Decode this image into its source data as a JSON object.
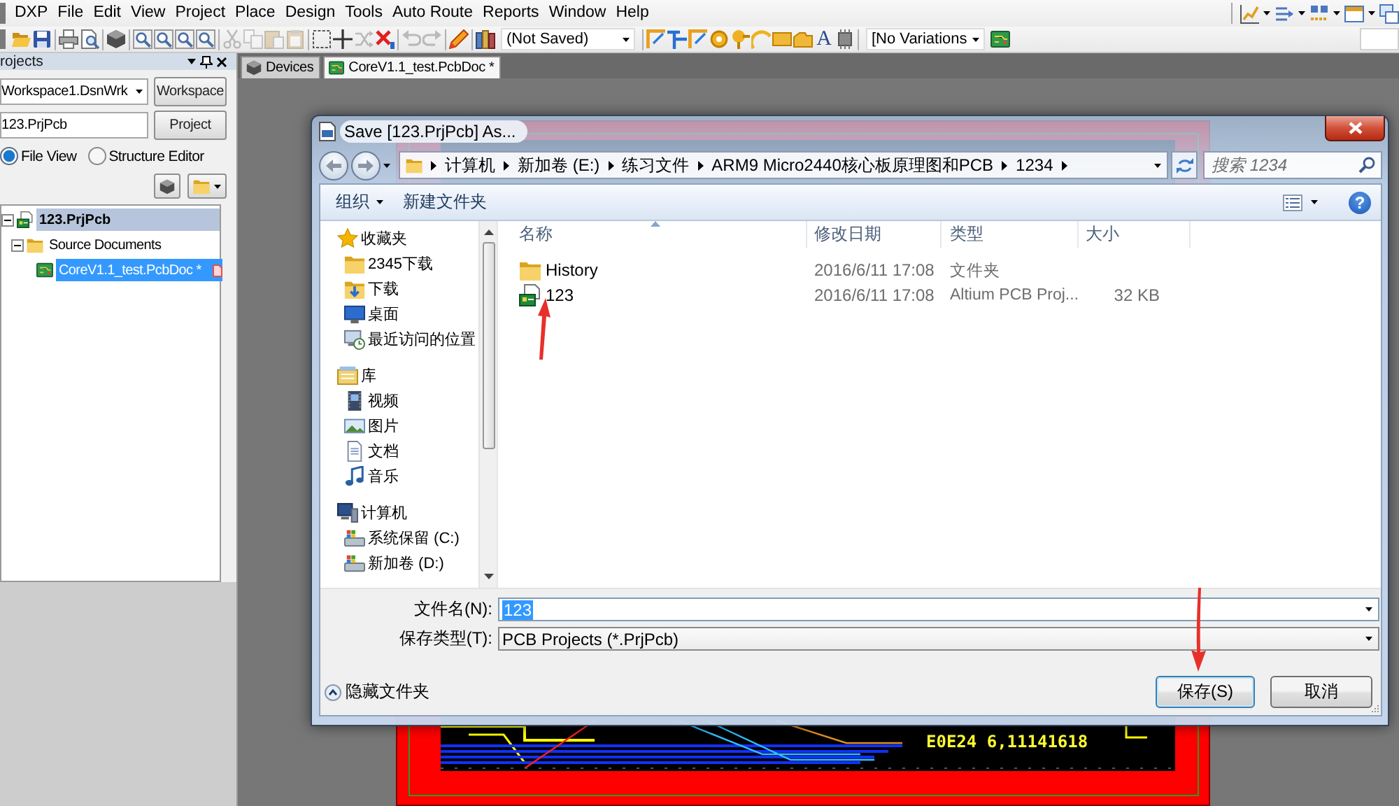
{
  "menu_bar": {
    "items": [
      "DXP",
      "File",
      "Edit",
      "View",
      "Project",
      "Place",
      "Design",
      "Tools",
      "Auto Route",
      "Reports",
      "Window",
      "Help"
    ],
    "tools": [
      {
        "kind": "chart"
      },
      {
        "kind": "align"
      },
      {
        "kind": "blocks"
      },
      {
        "kind": "panel"
      },
      {
        "kind": "windows"
      }
    ]
  },
  "toolbar": {
    "edit_groups": [
      [
        {
          "kind": "folder",
          "disabled": false
        },
        {
          "kind": "floppy",
          "disabled": false
        }
      ],
      [
        {
          "kind": "printer",
          "disabled": false
        },
        {
          "kind": "preview",
          "disabled": false
        }
      ],
      [
        {
          "kind": "cube",
          "disabled": false
        }
      ],
      [
        {
          "kind": "magnifier",
          "disabled": false
        },
        {
          "kind": "magnifier",
          "disabled": false
        },
        {
          "kind": "magnifier",
          "disabled": false
        },
        {
          "kind": "magnifier",
          "disabled": false
        }
      ],
      [
        {
          "kind": "scissors",
          "disabled": true
        },
        {
          "kind": "copy",
          "disabled": true
        },
        {
          "kind": "paste",
          "disabled": true
        },
        {
          "kind": "clipboard",
          "disabled": true
        }
      ],
      [
        {
          "kind": "selection",
          "disabled": false
        },
        {
          "kind": "crosshair",
          "disabled": false
        },
        {
          "kind": "shuffle",
          "disabled": true
        },
        {
          "kind": "xmark",
          "disabled": false
        }
      ],
      [
        {
          "kind": "undo",
          "disabled": true
        },
        {
          "kind": "redo",
          "disabled": true
        }
      ],
      [
        {
          "kind": "pencil",
          "disabled": false
        }
      ],
      [
        {
          "kind": "books",
          "disabled": false
        }
      ]
    ],
    "document_state": "(Not Saved)",
    "place_tools": [
      {
        "kind": "bracket",
        "disabled": false
      },
      {
        "kind": "flag",
        "disabled": false
      },
      {
        "kind": "bracket",
        "disabled": false
      },
      {
        "kind": "via",
        "disabled": false
      },
      {
        "kind": "pad",
        "disabled": false
      },
      {
        "kind": "arc",
        "disabled": false
      },
      {
        "kind": "fill",
        "disabled": false
      },
      {
        "kind": "polygon",
        "disabled": false
      },
      {
        "kind": "text",
        "label": "A",
        "disabled": false
      },
      {
        "kind": "chip",
        "disabled": false
      }
    ],
    "variations": "[No Variations",
    "variant_tools": [
      {
        "kind": "board",
        "disabled": false
      }
    ]
  },
  "projects_panel": {
    "title": "rojects",
    "workspace": "Workspace1.DsnWrk",
    "workspace_button": "Workspace",
    "project": "123.PrjPcb",
    "project_button": "Project",
    "views": [
      {
        "label": "File View",
        "selected": true
      },
      {
        "label": "Structure Editor",
        "selected": false
      }
    ],
    "tree": [
      {
        "kind": "project",
        "label": "123.PrjPcb",
        "selected": false,
        "active": true,
        "expanded": true,
        "modified": false,
        "children": [
          {
            "kind": "folder",
            "label": "Source Documents",
            "selected": false,
            "active": false,
            "expanded": true,
            "modified": false,
            "children": [
              {
                "kind": "pcbdoc",
                "label": "CoreV1.1_test.PcbDoc *",
                "selected": true,
                "active": false,
                "modified": true
              }
            ]
          }
        ]
      }
    ]
  },
  "document_tabs": [
    {
      "kind": "panel",
      "label": "Devices",
      "selected": false
    },
    {
      "kind": "pcbdoc",
      "label": "CoreV1.1_test.PcbDoc *",
      "selected": true
    }
  ],
  "pcb": {
    "silkscreen_text": "E0E24 6,11141618"
  },
  "save_dialog": {
    "title": "Save [123.PrjPcb] As...",
    "breadcrumb": [
      "计算机",
      "新加卷 (E:)",
      "练习文件",
      "ARM9 Micro2440核心板原理图和PCB",
      "1234"
    ],
    "search": {
      "placeholder": "搜索 1234"
    },
    "commands": [
      {
        "kind": "menu",
        "label": "组织"
      },
      {
        "kind": "button",
        "label": "新建文件夹"
      }
    ],
    "help": "?",
    "nav": [
      {
        "kind": "favorites",
        "label": "收藏夹",
        "children": [
          {
            "kind": "folder",
            "label": "2345下载"
          },
          {
            "kind": "downloads",
            "label": "下载"
          },
          {
            "kind": "desktop",
            "label": "桌面"
          },
          {
            "kind": "recent",
            "label": "最近访问的位置"
          }
        ]
      },
      {
        "kind": "libraries",
        "label": "库",
        "children": [
          {
            "kind": "videos",
            "label": "视频"
          },
          {
            "kind": "pictures",
            "label": "图片"
          },
          {
            "kind": "documents",
            "label": "文档"
          },
          {
            "kind": "music",
            "label": "音乐"
          }
        ]
      },
      {
        "kind": "computer",
        "label": "计算机",
        "children": [
          {
            "kind": "drive",
            "label": "系统保留 (C:)"
          },
          {
            "kind": "drive",
            "label": "新加卷 (D:)"
          }
        ]
      }
    ],
    "columns": [
      {
        "label": "名称",
        "sorted": true
      },
      {
        "label": "修改日期",
        "sorted": false
      },
      {
        "label": "类型",
        "sorted": false
      },
      {
        "label": "大小",
        "sorted": false
      }
    ],
    "files": [
      {
        "kind": "folder",
        "name": "History",
        "modified": "2016/6/11 17:08",
        "type": "文件夹"
      },
      {
        "kind": "project",
        "name": "123",
        "modified": "2016/6/11 17:08",
        "type": "Altium PCB Proj...",
        "size": "32 KB"
      }
    ],
    "file_name": {
      "label": "文件名(N):",
      "value": "123",
      "value_selected": true
    },
    "file_type": {
      "label": "保存类型(T):",
      "value": "PCB Projects (*.PrjPcb)"
    },
    "hide_folders": "隐藏文件夹",
    "buttons": [
      {
        "kind": "default",
        "label": "保存(S)"
      },
      {
        "kind": "normal",
        "label": "取消"
      }
    ]
  }
}
